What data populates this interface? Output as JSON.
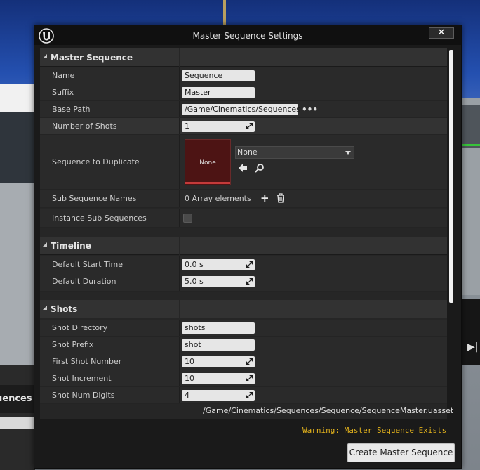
{
  "window": {
    "title": "Master Sequence Settings",
    "close_label": "✕"
  },
  "background": {
    "left_label": "uences"
  },
  "sections": {
    "master": {
      "label": "Master Sequence",
      "name_label": "Name",
      "name_value": "Sequence",
      "suffix_label": "Suffix",
      "suffix_value": "Master",
      "base_path_label": "Base Path",
      "base_path_value": "/Game/Cinematics/Sequences",
      "base_path_more": "•••",
      "num_shots_label": "Number of Shots",
      "num_shots_value": "1",
      "dup_label": "Sequence to Duplicate",
      "dup_thumb": "None",
      "dup_combo": "None",
      "sub_names_label": "Sub Sequence Names",
      "sub_names_value": "0 Array elements",
      "instance_label": "Instance Sub Sequences",
      "instance_checked": false
    },
    "timeline": {
      "label": "Timeline",
      "start_label": "Default Start Time",
      "start_value": "0.0 s",
      "duration_label": "Default Duration",
      "duration_value": "5.0 s"
    },
    "shots": {
      "label": "Shots",
      "dir_label": "Shot Directory",
      "dir_value": "shots",
      "prefix_label": "Shot Prefix",
      "prefix_value": "shot",
      "first_label": "First Shot Number",
      "first_value": "10",
      "incr_label": "Shot Increment",
      "incr_value": "10",
      "digits_label": "Shot Num Digits",
      "digits_value": "4"
    }
  },
  "footer": {
    "asset_path": "/Game/Cinematics/Sequences/Sequence/SequenceMaster.uasset",
    "warning": "Warning: Master Sequence Exists",
    "create_label": "Create Master Sequence"
  },
  "colors": {
    "warning": "#e2b21c",
    "thumb_bar": "#c43a3a",
    "scene_sky": "#2450b0"
  }
}
